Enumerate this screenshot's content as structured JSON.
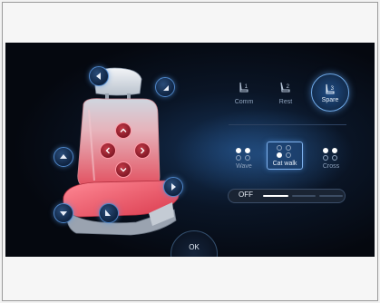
{
  "seat_controls": {
    "position_buttons": [
      {
        "name": "seat-recline-back-button",
        "icon": "arrow-left-icon"
      },
      {
        "name": "seat-recline-forward-button",
        "icon": "arrow-down-left-icon"
      },
      {
        "name": "seat-raise-button",
        "icon": "arrow-up-icon"
      },
      {
        "name": "seat-lower-button",
        "icon": "arrow-down-icon"
      },
      {
        "name": "seat-cushion-tilt-button",
        "icon": "arrow-down-left-icon"
      },
      {
        "name": "seat-slide-button",
        "icon": "arrow-right-icon"
      }
    ],
    "lumbar_pad": [
      "chevron-up-icon",
      "chevron-left-icon",
      "chevron-right-icon",
      "chevron-down-icon"
    ]
  },
  "memory_modes": {
    "items": [
      {
        "label": "Comm",
        "subscript": "1",
        "active": false
      },
      {
        "label": "Rest",
        "subscript": "2",
        "active": false
      },
      {
        "label": "Spare",
        "subscript": "3",
        "active": true
      }
    ]
  },
  "massage": {
    "items": [
      {
        "label": "Wave",
        "active": false
      },
      {
        "label": "Cat walk",
        "active": true
      },
      {
        "label": "Cross",
        "active": false
      }
    ]
  },
  "intensity": {
    "label": "OFF",
    "level": 0.33
  },
  "ok_label": "OK",
  "colors": {
    "accent": "#4f86c9",
    "heat": "#e0505e",
    "background": "#05080f"
  }
}
